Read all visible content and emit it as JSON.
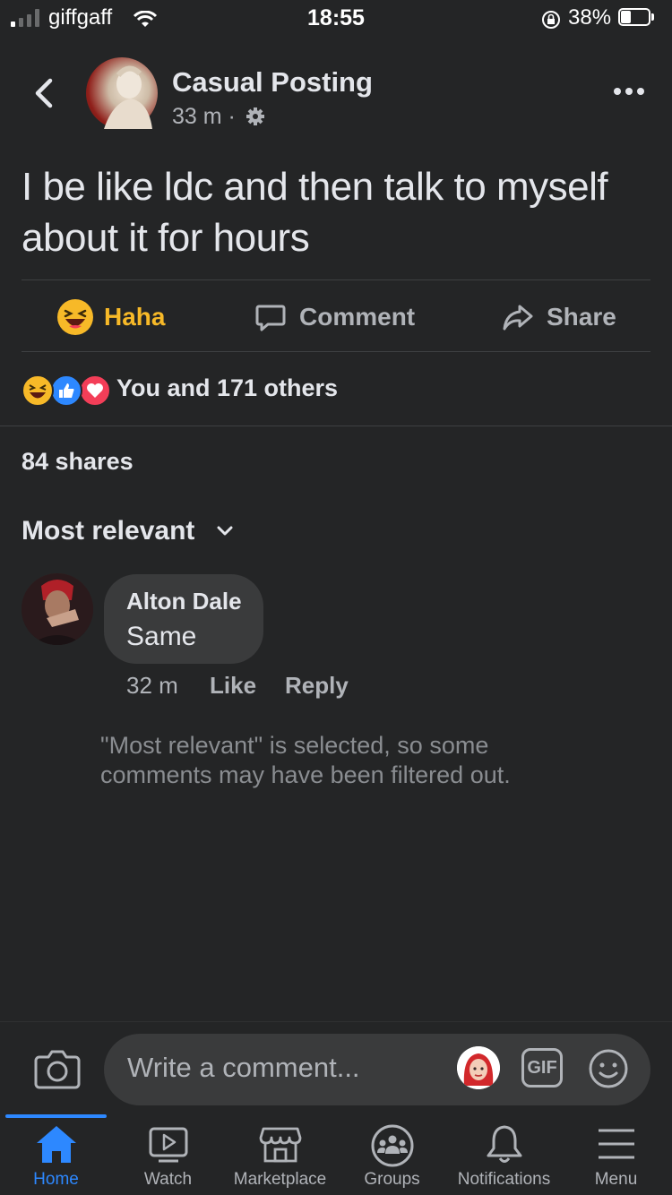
{
  "status_bar": {
    "carrier": "giffgaff",
    "time": "18:55",
    "battery_percent": "38%",
    "battery_level": 0.38
  },
  "post": {
    "page_name": "Casual Posting",
    "time_ago": "33 m",
    "separator": "·",
    "text": "I be like ldc and then talk to myself about it for hours"
  },
  "actions": {
    "haha": "Haha",
    "comment": "Comment",
    "share": "Share"
  },
  "reactions": {
    "summary": "You and 171 others",
    "types": [
      "haha",
      "like",
      "love"
    ]
  },
  "shares_count": "84 shares",
  "sort": {
    "label": "Most relevant"
  },
  "comments": [
    {
      "author": "Alton Dale",
      "text": "Same",
      "time": "32 m",
      "like": "Like",
      "reply": "Reply"
    }
  ],
  "filter_note": "\"Most relevant\" is selected, so some comments may have been filtered out.",
  "composer": {
    "placeholder": "Write a comment...",
    "gif": "GIF"
  },
  "tabs": [
    {
      "label": "Home",
      "icon": "home-icon",
      "active": true
    },
    {
      "label": "Watch",
      "icon": "watch-icon",
      "active": false
    },
    {
      "label": "Marketplace",
      "icon": "marketplace-icon",
      "active": false
    },
    {
      "label": "Groups",
      "icon": "groups-icon",
      "active": false
    },
    {
      "label": "Notifications",
      "icon": "bell-icon",
      "active": false
    },
    {
      "label": "Menu",
      "icon": "menu-icon",
      "active": false
    }
  ],
  "colors": {
    "background": "#242526",
    "accent": "#2d88ff",
    "haha": "#f7b928",
    "love": "#f33e58"
  }
}
